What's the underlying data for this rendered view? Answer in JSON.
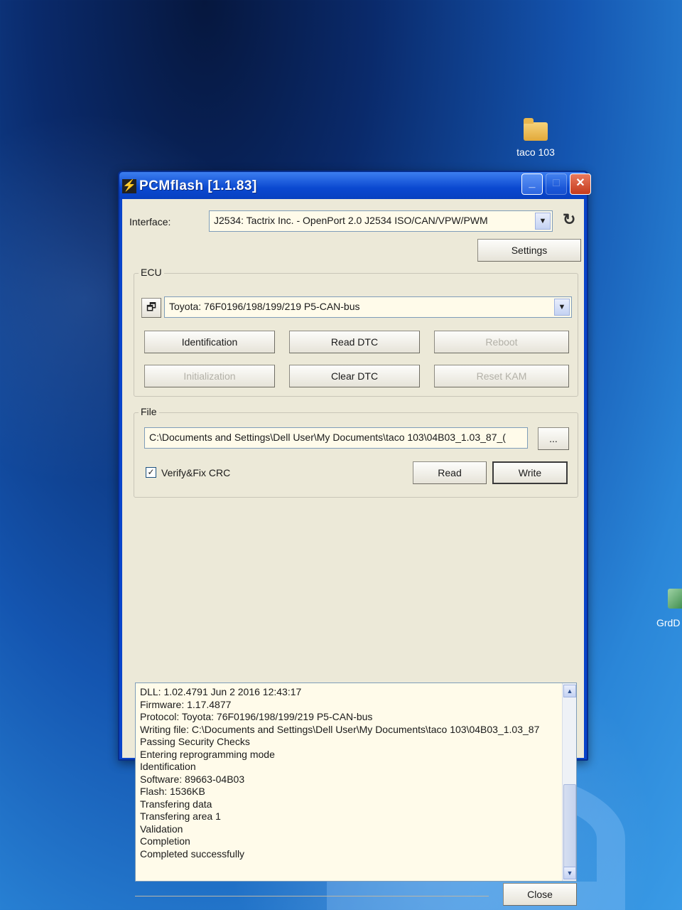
{
  "desktop": {
    "icons": [
      {
        "label": "taco 103",
        "icon": "folder-icon"
      },
      {
        "label": "GrdD",
        "icon": "app-icon"
      }
    ]
  },
  "window": {
    "title": "PCMflash [1.1.83]",
    "app_icon_glyph": "⚡",
    "controls": {
      "minimize": "_",
      "maximize": "□",
      "close": "✕"
    }
  },
  "interface": {
    "label": "Interface:",
    "value": "J2534: Tactrix Inc. - OpenPort 2.0 J2534 ISO/CAN/VPW/PWM",
    "refresh_glyph": "↻",
    "settings_label": "Settings"
  },
  "ecu": {
    "group_label": "ECU",
    "window_glyph": "🗗",
    "selected": "Toyota: 76F0196/198/199/219 P5-CAN-bus",
    "buttons": {
      "identification": "Identification",
      "read_dtc": "Read DTC",
      "reboot": "Reboot",
      "initialization": "Initialization",
      "clear_dtc": "Clear DTC",
      "reset_kam": "Reset KAM"
    }
  },
  "file": {
    "group_label": "File",
    "path": "C:\\Documents and Settings\\Dell User\\My Documents\\taco 103\\04B03_1.03_87_(",
    "browse_label": "...",
    "verify_label": "Verify&Fix CRC",
    "verify_checked": true,
    "check_glyph": "✓",
    "read_label": "Read",
    "write_label": "Write"
  },
  "log": {
    "lines": [
      "DLL: 1.02.4791 Jun  2 2016 12:43:17",
      "Firmware: 1.17.4877",
      "Protocol: Toyota: 76F0196/198/199/219 P5-CAN-bus",
      "Writing file: C:\\Documents and Settings\\Dell User\\My Documents\\taco 103\\04B03_1.03_87",
      "Passing Security Checks",
      "Entering reprogramming mode",
      "Identification",
      "Software: 89663-04B03",
      "Flash: 1536KB",
      "Transfering data",
      "Transfering area 1",
      "Validation",
      "Completion",
      "Completed successfully"
    ],
    "scroll_up": "▲",
    "scroll_down": "▼"
  },
  "footer": {
    "close_label": "Close"
  }
}
